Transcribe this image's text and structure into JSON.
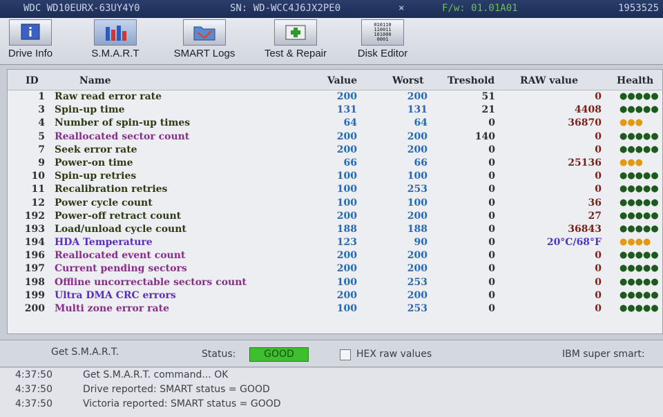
{
  "titlebar": {
    "model": "WDC WD10EURX-63UY4Y0",
    "serial": "SN: WD-WCC4J6JX2PE0",
    "close": "×",
    "firmware": "F/w: 01.01A01",
    "lba": "1953525"
  },
  "toolbar": {
    "drive_info": "Drive Info",
    "smart": "S.M.A.R.T",
    "smart_logs": "SMART Logs",
    "test_repair": "Test & Repair",
    "disk_editor": "Disk Editor",
    "disk_editor_icon_text": "010110 110011 101000 0001"
  },
  "table": {
    "headers": {
      "id": "ID",
      "name": "Name",
      "value": "Value",
      "worst": "Worst",
      "threshold": "Treshold",
      "raw": "RAW value",
      "health": "Health"
    },
    "rows": [
      {
        "id": "1",
        "name": "Raw read error rate",
        "value": "200",
        "worst": "200",
        "thr": "51",
        "raw": "0",
        "health": "●●●●●",
        "style": "ok"
      },
      {
        "id": "3",
        "name": "Spin-up time",
        "value": "131",
        "worst": "131",
        "thr": "21",
        "raw": "4408",
        "health": "●●●●●",
        "style": "ok"
      },
      {
        "id": "4",
        "name": "Number of spin-up times",
        "value": "64",
        "worst": "64",
        "thr": "0",
        "raw": "36870",
        "health": "●●●",
        "style": "ok"
      },
      {
        "id": "5",
        "name": "Reallocated sector count",
        "value": "200",
        "worst": "200",
        "thr": "140",
        "raw": "0",
        "health": "●●●●●",
        "style": "warn"
      },
      {
        "id": "7",
        "name": "Seek error rate",
        "value": "200",
        "worst": "200",
        "thr": "0",
        "raw": "0",
        "health": "●●●●●",
        "style": "ok"
      },
      {
        "id": "9",
        "name": "Power-on time",
        "value": "66",
        "worst": "66",
        "thr": "0",
        "raw": "25136",
        "health": "●●●",
        "style": "ok"
      },
      {
        "id": "10",
        "name": "Spin-up retries",
        "value": "100",
        "worst": "100",
        "thr": "0",
        "raw": "0",
        "health": "●●●●●",
        "style": "ok"
      },
      {
        "id": "11",
        "name": "Recalibration retries",
        "value": "100",
        "worst": "253",
        "thr": "0",
        "raw": "0",
        "health": "●●●●●",
        "style": "ok"
      },
      {
        "id": "12",
        "name": "Power cycle count",
        "value": "100",
        "worst": "100",
        "thr": "0",
        "raw": "36",
        "health": "●●●●●",
        "style": "ok"
      },
      {
        "id": "192",
        "name": "Power-off retract count",
        "value": "200",
        "worst": "200",
        "thr": "0",
        "raw": "27",
        "health": "●●●●●",
        "style": "ok"
      },
      {
        "id": "193",
        "name": "Load/unload cycle count",
        "value": "188",
        "worst": "188",
        "thr": "0",
        "raw": "36843",
        "health": "●●●●●",
        "style": "ok"
      },
      {
        "id": "194",
        "name": "HDA Temperature",
        "value": "123",
        "worst": "90",
        "thr": "0",
        "raw": "20°C/68°F",
        "health": "●●●●",
        "style": "info"
      },
      {
        "id": "196",
        "name": "Reallocated event count",
        "value": "200",
        "worst": "200",
        "thr": "0",
        "raw": "0",
        "health": "●●●●●",
        "style": "warn"
      },
      {
        "id": "197",
        "name": "Current pending sectors",
        "value": "200",
        "worst": "200",
        "thr": "0",
        "raw": "0",
        "health": "●●●●●",
        "style": "warn"
      },
      {
        "id": "198",
        "name": "Offline uncorrectable sectors count",
        "value": "100",
        "worst": "253",
        "thr": "0",
        "raw": "0",
        "health": "●●●●●",
        "style": "warn"
      },
      {
        "id": "199",
        "name": "Ultra DMA CRC errors",
        "value": "200",
        "worst": "200",
        "thr": "0",
        "raw": "0",
        "health": "●●●●●",
        "style": "info"
      },
      {
        "id": "200",
        "name": "Multi zone error rate",
        "value": "100",
        "worst": "253",
        "thr": "0",
        "raw": "0",
        "health": "●●●●●",
        "style": "warn"
      }
    ]
  },
  "colors": {
    "health_good": "#1e5a1e",
    "health_warn": "#e49a10",
    "status_good": "#3fbf2d"
  },
  "statusbar": {
    "get_smart": "Get S.M.A.R.T.",
    "status_label": "Status:",
    "status_value": "GOOD",
    "hex_label": "HEX raw values",
    "ibm_label": "IBM super smart:  "
  },
  "log": [
    {
      "time": "4:37:50",
      "msg": "Get S.M.A.R.T. command... OK"
    },
    {
      "time": "4:37:50",
      "msg": "Drive reported: SMART status = GOOD"
    },
    {
      "time": "4:37:50",
      "msg": "Victoria reported: SMART status = GOOD"
    }
  ]
}
